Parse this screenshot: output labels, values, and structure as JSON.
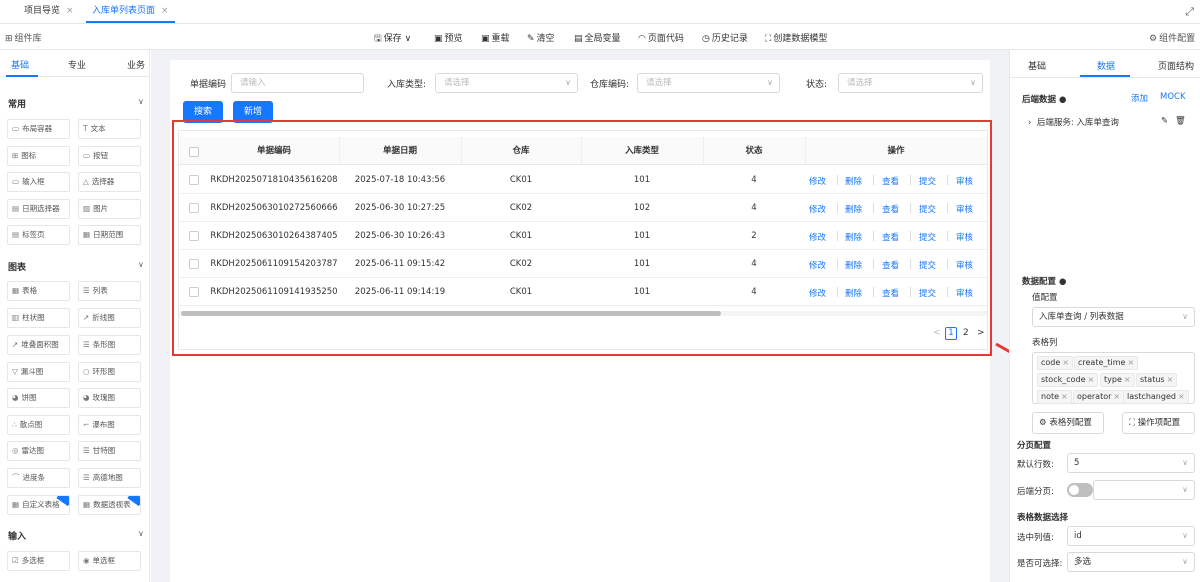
{
  "tabs": [
    {
      "label": "项目导览",
      "close": "×"
    },
    {
      "label": "入库单列表页面",
      "close": "×"
    }
  ],
  "toolbar": {
    "component_lib": "组件库",
    "save": "保存",
    "preview": "预览",
    "reload": "重载",
    "clear": "清空",
    "global_vars": "全局变量",
    "page_code": "页面代码",
    "history": "历史记录",
    "create_model": "创建数据模型",
    "component_config": "组件配置"
  },
  "left": {
    "tabs": [
      "基础",
      "专业",
      "业务"
    ],
    "sections": [
      {
        "title": "常用",
        "items": [
          "布局容器",
          "文本",
          "图标",
          "按钮",
          "输入框",
          "选择器",
          "日期选择器",
          "图片",
          "标签页",
          "日期范围"
        ]
      },
      {
        "title": "图表",
        "items": [
          "表格",
          "列表",
          "柱状图",
          "折线图",
          "堆叠面积图",
          "条形图",
          "漏斗图",
          "环形图",
          "饼图",
          "玫瑰图",
          "散点图",
          "瀑布图",
          "雷达图",
          "甘特图",
          "进度条",
          "高德地图",
          "自定义表格",
          "数据透视表"
        ]
      },
      {
        "title": "输入",
        "items": [
          "多选框",
          "单选框"
        ]
      }
    ]
  },
  "form": {
    "order_no_label": "单据编码",
    "order_no_placeholder": "请输入",
    "type_label": "入库类型:",
    "type_placeholder": "请选择",
    "warehouse_label": "仓库编码:",
    "warehouse_placeholder": "请选择",
    "status_label": "状态:",
    "status_placeholder": "请选择",
    "search_btn": "搜索",
    "add_btn": "新增"
  },
  "table": {
    "headers": [
      "单据编码",
      "单据日期",
      "仓库",
      "入库类型",
      "状态",
      "操作"
    ],
    "rows": [
      [
        "RKDH2025071810435616208",
        "2025-07-18 10:43:56",
        "CK01",
        "101",
        "4"
      ],
      [
        "RKDH2025063010272560666",
        "2025-06-30 10:27:25",
        "CK02",
        "102",
        "4"
      ],
      [
        "RKDH2025063010264387405",
        "2025-06-30 10:26:43",
        "CK01",
        "101",
        "2"
      ],
      [
        "RKDH2025061109154203787",
        "2025-06-11 09:15:42",
        "CK02",
        "101",
        "4"
      ],
      [
        "RKDH2025061109141935250",
        "2025-06-11 09:14:19",
        "CK01",
        "101",
        "4"
      ]
    ],
    "ops": [
      "修改",
      "删除",
      "查看",
      "提交",
      "审核"
    ],
    "pager": {
      "prev": "<",
      "current": "1",
      "next_page": "2",
      "next": ">"
    }
  },
  "right": {
    "tabs": [
      "基础",
      "数据",
      "页面结构"
    ],
    "backend_title": "后端数据",
    "add": "添加",
    "mock": "MOCK",
    "service": "后端服务: 入库单查询",
    "data_config_title": "数据配置",
    "value_config": "值配置",
    "value_select": "入库单查询 / 列表数据",
    "table_cols": "表格列",
    "tags": [
      "code",
      "create_time",
      "type",
      "status",
      "stock_code",
      "type",
      "status",
      "note",
      "operator",
      "lastchanged"
    ],
    "col_config_btn": "表格列配置",
    "op_config_btn": "操作项配置",
    "paging_title": "分页配置",
    "default_rows_label": "默认行数:",
    "default_rows": "5",
    "backend_paging_label": "后端分页:",
    "table_select_title": "表格数据选择",
    "selected_col_label": "选中列值:",
    "selected_col": "id",
    "multi_label": "是否可选择:",
    "multi_value": "多选"
  }
}
